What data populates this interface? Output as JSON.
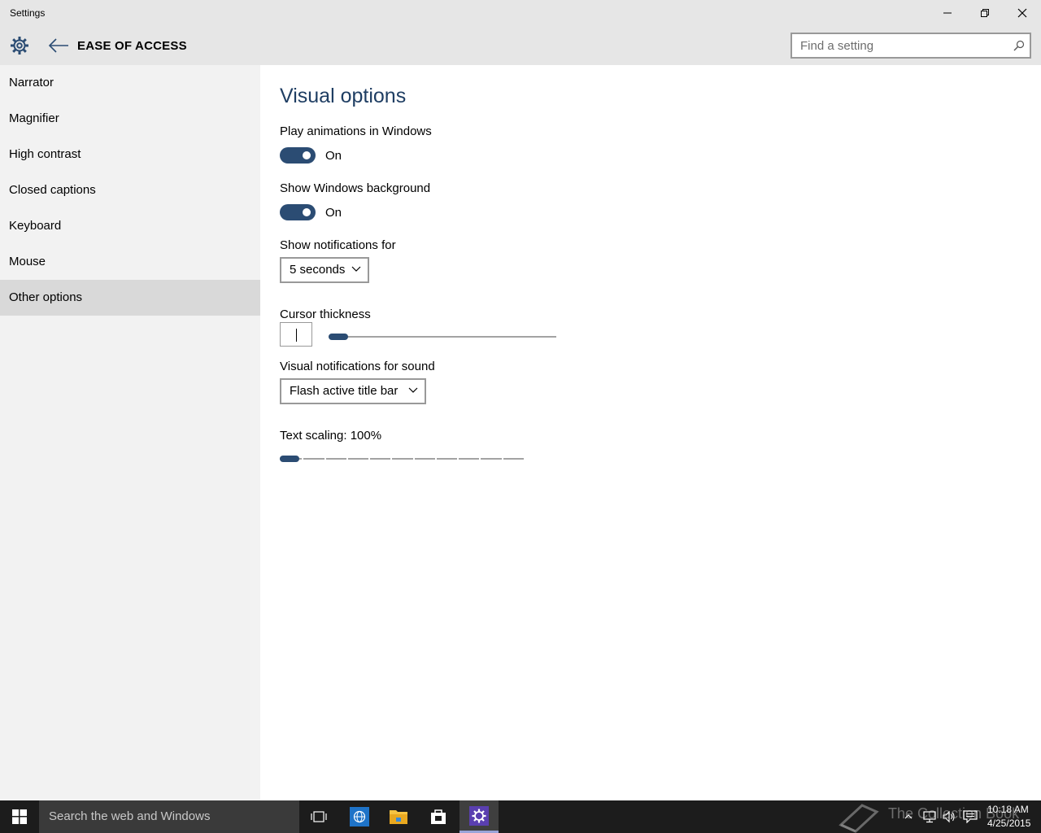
{
  "window": {
    "title": "Settings"
  },
  "header": {
    "section_title": "EASE OF ACCESS",
    "search_placeholder": "Find a setting"
  },
  "sidebar": {
    "items": [
      {
        "label": "Narrator"
      },
      {
        "label": "Magnifier"
      },
      {
        "label": "High contrast"
      },
      {
        "label": "Closed captions"
      },
      {
        "label": "Keyboard"
      },
      {
        "label": "Mouse"
      },
      {
        "label": "Other options",
        "selected": true
      }
    ]
  },
  "main": {
    "heading": "Visual options",
    "play_animations": {
      "label": "Play animations in Windows",
      "state": "On"
    },
    "show_background": {
      "label": "Show Windows background",
      "state": "On"
    },
    "notifications": {
      "label": "Show notifications for",
      "value": "5 seconds"
    },
    "cursor_thickness": {
      "label": "Cursor thickness",
      "value_fraction": 0.0
    },
    "visual_notifications": {
      "label": "Visual notifications for sound",
      "value": "Flash active title bar"
    },
    "text_scaling": {
      "label": "Text scaling: 100%",
      "value_fraction": 0.0
    }
  },
  "taskbar": {
    "search_placeholder": "Search the web and Windows",
    "watermark": "The Collection Book",
    "time": "10:18 AM",
    "date": "4/25/2015"
  },
  "colors": {
    "accent": "#2b4c73",
    "heading": "#1f3e63",
    "sidebar_bg": "#f2f2f2",
    "selected_item_bg": "#d9d9d9",
    "taskbar_bg": "#1c1c1c"
  }
}
